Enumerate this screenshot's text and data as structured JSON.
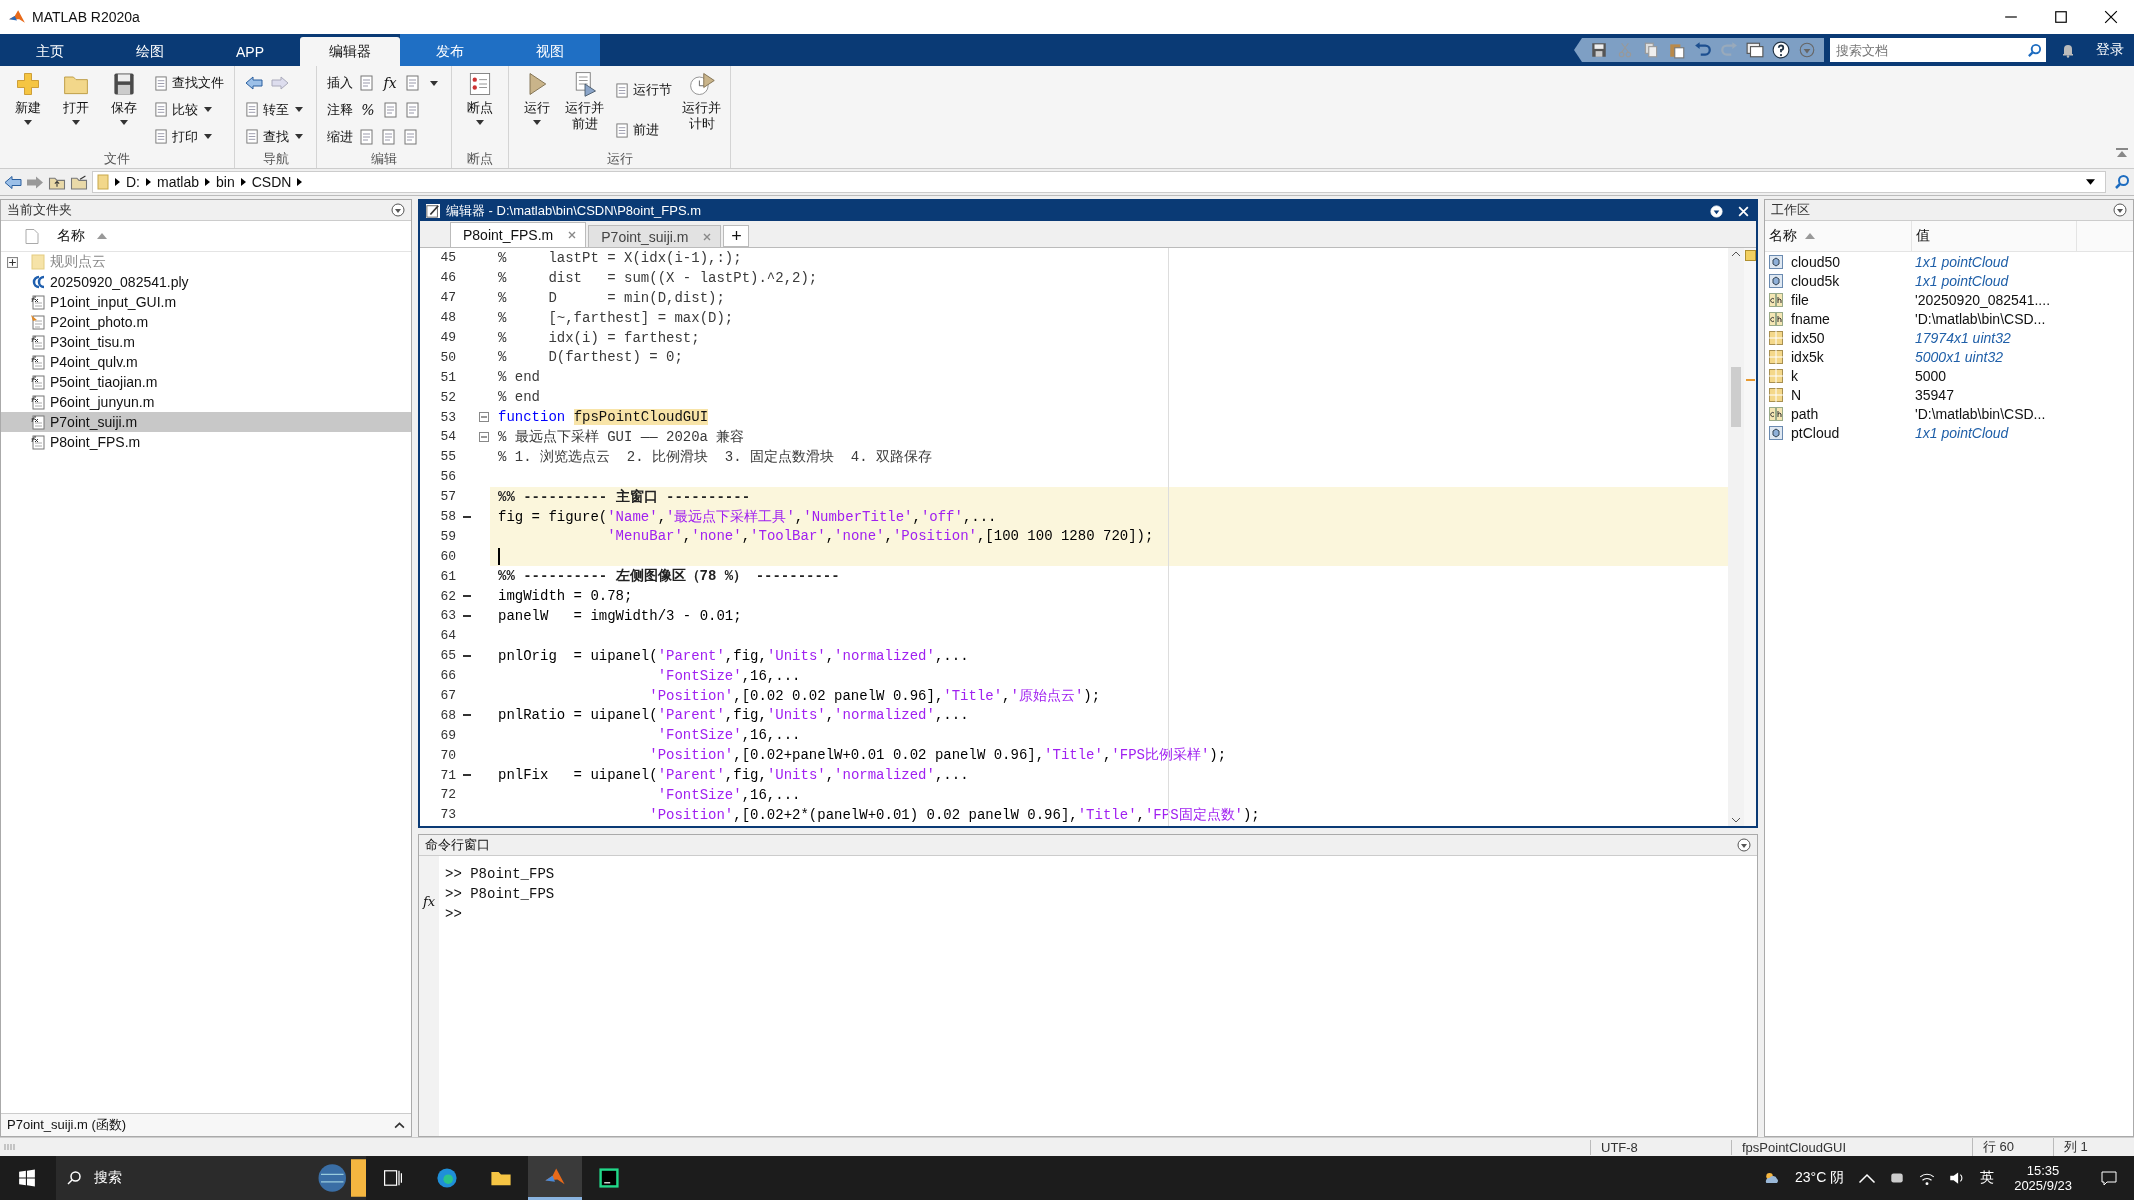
{
  "window": {
    "title": "MATLAB R2020a"
  },
  "tabs": [
    {
      "label": "主页",
      "selected": false,
      "contextual": false
    },
    {
      "label": "绘图",
      "selected": false,
      "contextual": false
    },
    {
      "label": "APP",
      "selected": false,
      "contextual": false
    },
    {
      "label": "编辑器",
      "selected": true,
      "contextual": true
    },
    {
      "label": "发布",
      "selected": false,
      "contextual": true
    },
    {
      "label": "视图",
      "selected": false,
      "contextual": true
    }
  ],
  "search": {
    "placeholder": "搜索文档"
  },
  "login": "登录",
  "ribbon": [
    {
      "label": "文件",
      "items": [
        {
          "kind": "big",
          "label": "新建",
          "caret": true
        },
        {
          "kind": "big",
          "label": "打开",
          "caret": true
        },
        {
          "kind": "big",
          "label": "保存",
          "caret": true
        },
        {
          "kind": "column",
          "rows": [
            {
              "kind": "small",
              "label": "查找文件",
              "caret": false
            },
            {
              "kind": "small",
              "label": "比较",
              "caret": true
            },
            {
              "kind": "small",
              "label": "打印",
              "caret": true
            }
          ]
        }
      ]
    },
    {
      "label": "导航",
      "items": [
        {
          "kind": "column",
          "rows": [
            {
              "kind": "arrows"
            },
            {
              "kind": "small",
              "label": "转至",
              "caret": true
            },
            {
              "kind": "small",
              "label": "查找",
              "caret": true
            }
          ]
        }
      ]
    },
    {
      "label": "编辑",
      "items": [
        {
          "kind": "column",
          "rows": [
            {
              "kind": "tools",
              "label": "插入",
              "tools": [
                {
                  "kind": "icon"
                },
                {
                  "kind": "glyph",
                  "text": "fx"
                },
                {
                  "kind": "icon",
                  "caret": true
                }
              ]
            },
            {
              "kind": "tools",
              "label": "注释",
              "tools": [
                {
                  "kind": "glyph",
                  "text": "%"
                },
                {
                  "kind": "icon"
                },
                {
                  "kind": "icon"
                }
              ]
            },
            {
              "kind": "tools",
              "label": "缩进",
              "tools": [
                {
                  "kind": "icon"
                },
                {
                  "kind": "icon"
                },
                {
                  "kind": "icon"
                }
              ]
            }
          ]
        }
      ]
    },
    {
      "label": "断点",
      "items": [
        {
          "kind": "big",
          "label": "断点",
          "caret": true
        }
      ]
    },
    {
      "label": "运行",
      "items": [
        {
          "kind": "big",
          "label": "运行",
          "caret": true
        },
        {
          "kind": "big",
          "label": "运行并前进",
          "caret": false
        },
        {
          "kind": "column",
          "rows": [
            {
              "kind": "small",
              "label": "运行节",
              "caret": false
            },
            {
              "kind": "small",
              "label": "前进",
              "caret": false
            }
          ]
        },
        {
          "kind": "big",
          "label": "运行并计时",
          "caret": false
        }
      ]
    }
  ],
  "path": [
    "D:",
    "matlab",
    "bin",
    "CSDN"
  ],
  "current_folder": {
    "title": "当前文件夹",
    "column": "名称",
    "items": [
      {
        "name": "规则点云",
        "kind": "folder",
        "selected": false
      },
      {
        "name": "20250920_082541.ply",
        "kind": "ply",
        "selected": false
      },
      {
        "name": "P1oint_input_GUI.m",
        "kind": "function",
        "selected": false
      },
      {
        "name": "P2oint_photo.m",
        "kind": "script",
        "selected": false
      },
      {
        "name": "P3oint_tisu.m",
        "kind": "function",
        "selected": false
      },
      {
        "name": "P4oint_qulv.m",
        "kind": "function",
        "selected": false
      },
      {
        "name": "P5oint_tiaojian.m",
        "kind": "function",
        "selected": false
      },
      {
        "name": "P6oint_junyun.m",
        "kind": "function",
        "selected": false
      },
      {
        "name": "P7oint_suiji.m",
        "kind": "function",
        "selected": true
      },
      {
        "name": "P8oint_FPS.m",
        "kind": "function",
        "selected": false
      }
    ],
    "details": "P7oint_suiji.m  (函数)"
  },
  "editor": {
    "title": "编辑器 - D:\\matlab\\bin\\CSDN\\P8oint_FPS.m",
    "tabs": [
      {
        "label": "P8oint_FPS.m",
        "selected": true
      },
      {
        "label": "P7oint_suiji.m",
        "selected": false
      }
    ],
    "add_tab": "+",
    "lines": [
      {
        "number": "45",
        "executable": false,
        "fold": false,
        "cell": false,
        "cursor": false,
        "segments": [
          {
            "kind": "comment",
            "text": "%     lastPt = X(idx(i-1),:);"
          }
        ]
      },
      {
        "number": "46",
        "executable": false,
        "fold": false,
        "cell": false,
        "cursor": false,
        "segments": [
          {
            "kind": "comment",
            "text": "%     dist   = sum((X - lastPt).^2,2);"
          }
        ]
      },
      {
        "number": "47",
        "executable": false,
        "fold": false,
        "cell": false,
        "cursor": false,
        "segments": [
          {
            "kind": "comment",
            "text": "%     D      = min(D,dist);"
          }
        ]
      },
      {
        "number": "48",
        "executable": false,
        "fold": false,
        "cell": false,
        "cursor": false,
        "segments": [
          {
            "kind": "comment",
            "text": "%     [~,farthest] = max(D);"
          }
        ]
      },
      {
        "number": "49",
        "executable": false,
        "fold": false,
        "cell": false,
        "cursor": false,
        "segments": [
          {
            "kind": "comment",
            "text": "%     idx(i) = farthest;"
          }
        ]
      },
      {
        "number": "50",
        "executable": false,
        "fold": false,
        "cell": false,
        "cursor": false,
        "segments": [
          {
            "kind": "comment",
            "text": "%     D(farthest) = 0;"
          }
        ]
      },
      {
        "number": "51",
        "executable": false,
        "fold": false,
        "cell": false,
        "cursor": false,
        "segments": [
          {
            "kind": "comment",
            "text": "% end"
          }
        ]
      },
      {
        "number": "52",
        "executable": false,
        "fold": false,
        "cell": false,
        "cursor": false,
        "segments": [
          {
            "kind": "comment",
            "text": "% end"
          }
        ]
      },
      {
        "number": "53",
        "executable": false,
        "fold": true,
        "cell": false,
        "cursor": false,
        "segments": [
          {
            "kind": "keyword",
            "text": "function "
          },
          {
            "kind": "highlight",
            "text": "fpsPointCloudGUI"
          }
        ]
      },
      {
        "number": "54",
        "executable": false,
        "fold": true,
        "cell": false,
        "cursor": false,
        "segments": [
          {
            "kind": "comment",
            "text": "% 最远点下采样 GUI —— 2020a 兼容"
          }
        ]
      },
      {
        "number": "55",
        "executable": false,
        "fold": false,
        "cell": false,
        "cursor": false,
        "segments": [
          {
            "kind": "comment",
            "text": "% 1. 浏览选点云  2. 比例滑块  3. 固定点数滑块  4. 双路保存"
          }
        ]
      },
      {
        "number": "56",
        "executable": false,
        "fold": false,
        "cell": false,
        "cursor": false
      },
      {
        "number": "57",
        "executable": false,
        "fold": false,
        "cell": true,
        "cursor": false,
        "segments": [
          {
            "kind": "section",
            "text": "%% ---------- 主窗口 ----------"
          }
        ]
      },
      {
        "number": "58",
        "executable": true,
        "fold": false,
        "cell": true,
        "cursor": false,
        "segments": [
          {
            "kind": "code",
            "text": "fig = figure("
          },
          {
            "kind": "string",
            "text": "'Name'"
          },
          {
            "kind": "code",
            "text": ","
          },
          {
            "kind": "string",
            "text": "'最远点下采样工具'"
          },
          {
            "kind": "code",
            "text": ","
          },
          {
            "kind": "string",
            "text": "'NumberTitle'"
          },
          {
            "kind": "code",
            "text": ","
          },
          {
            "kind": "string",
            "text": "'off'"
          },
          {
            "kind": "code",
            "text": ",..."
          }
        ]
      },
      {
        "number": "59",
        "executable": false,
        "fold": false,
        "cell": true,
        "cursor": false,
        "segments": [
          {
            "kind": "string",
            "text": "             'MenuBar'"
          },
          {
            "kind": "code",
            "text": ","
          },
          {
            "kind": "string",
            "text": "'none'"
          },
          {
            "kind": "code",
            "text": ","
          },
          {
            "kind": "string",
            "text": "'ToolBar'"
          },
          {
            "kind": "code",
            "text": ","
          },
          {
            "kind": "string",
            "text": "'none'"
          },
          {
            "kind": "code",
            "text": ","
          },
          {
            "kind": "string",
            "text": "'Position'"
          },
          {
            "kind": "code",
            "text": ",[100 100 1280 720]);"
          }
        ]
      },
      {
        "number": "60",
        "executable": false,
        "fold": false,
        "cell": true,
        "cursor": true
      },
      {
        "number": "61",
        "executable": false,
        "fold": false,
        "cell": false,
        "cursor": false,
        "segments": [
          {
            "kind": "section",
            "text": "%% ---------- 左侧图像区（78 %） ----------"
          }
        ]
      },
      {
        "number": "62",
        "executable": true,
        "fold": false,
        "cell": false,
        "cursor": false,
        "segments": [
          {
            "kind": "code",
            "text": "imgWidth = 0.78;"
          }
        ]
      },
      {
        "number": "63",
        "executable": true,
        "fold": false,
        "cell": false,
        "cursor": false,
        "segments": [
          {
            "kind": "code",
            "text": "panelW   = imgWidth/3 - 0.01;"
          }
        ]
      },
      {
        "number": "64",
        "executable": false,
        "fold": false,
        "cell": false,
        "cursor": false
      },
      {
        "number": "65",
        "executable": true,
        "fold": false,
        "cell": false,
        "cursor": false,
        "segments": [
          {
            "kind": "code",
            "text": "pnlOrig  = uipanel("
          },
          {
            "kind": "string",
            "text": "'Parent'"
          },
          {
            "kind": "code",
            "text": ",fig,"
          },
          {
            "kind": "string",
            "text": "'Units'"
          },
          {
            "kind": "code",
            "text": ","
          },
          {
            "kind": "string",
            "text": "'normalized'"
          },
          {
            "kind": "code",
            "text": ",..."
          }
        ]
      },
      {
        "number": "66",
        "executable": false,
        "fold": false,
        "cell": false,
        "cursor": false,
        "segments": [
          {
            "kind": "string",
            "text": "                   'FontSize'"
          },
          {
            "kind": "code",
            "text": ",16,..."
          }
        ]
      },
      {
        "number": "67",
        "executable": false,
        "fold": false,
        "cell": false,
        "cursor": false,
        "segments": [
          {
            "kind": "string",
            "text": "                  'Position'"
          },
          {
            "kind": "code",
            "text": ",[0.02 0.02 panelW 0.96],"
          },
          {
            "kind": "string",
            "text": "'Title'"
          },
          {
            "kind": "code",
            "text": ","
          },
          {
            "kind": "string",
            "text": "'原始点云'"
          },
          {
            "kind": "code",
            "text": ");"
          }
        ]
      },
      {
        "number": "68",
        "executable": true,
        "fold": false,
        "cell": false,
        "cursor": false,
        "segments": [
          {
            "kind": "code",
            "text": "pnlRatio = uipanel("
          },
          {
            "kind": "string",
            "text": "'Parent'"
          },
          {
            "kind": "code",
            "text": ",fig,"
          },
          {
            "kind": "string",
            "text": "'Units'"
          },
          {
            "kind": "code",
            "text": ","
          },
          {
            "kind": "string",
            "text": "'normalized'"
          },
          {
            "kind": "code",
            "text": ",..."
          }
        ]
      },
      {
        "number": "69",
        "executable": false,
        "fold": false,
        "cell": false,
        "cursor": false,
        "segments": [
          {
            "kind": "string",
            "text": "                   'FontSize'"
          },
          {
            "kind": "code",
            "text": ",16,..."
          }
        ]
      },
      {
        "number": "70",
        "executable": false,
        "fold": false,
        "cell": false,
        "cursor": false,
        "segments": [
          {
            "kind": "string",
            "text": "                  'Position'"
          },
          {
            "kind": "code",
            "text": ",[0.02+panelW+0.01 0.02 panelW 0.96],"
          },
          {
            "kind": "string",
            "text": "'Title'"
          },
          {
            "kind": "code",
            "text": ","
          },
          {
            "kind": "string",
            "text": "'FPS比例采样'"
          },
          {
            "kind": "code",
            "text": ");"
          }
        ]
      },
      {
        "number": "71",
        "executable": true,
        "fold": false,
        "cell": false,
        "cursor": false,
        "segments": [
          {
            "kind": "code",
            "text": "pnlFix   = uipanel("
          },
          {
            "kind": "string",
            "text": "'Parent'"
          },
          {
            "kind": "code",
            "text": ",fig,"
          },
          {
            "kind": "string",
            "text": "'Units'"
          },
          {
            "kind": "code",
            "text": ","
          },
          {
            "kind": "string",
            "text": "'normalized'"
          },
          {
            "kind": "code",
            "text": ",..."
          }
        ]
      },
      {
        "number": "72",
        "executable": false,
        "fold": false,
        "cell": false,
        "cursor": false,
        "segments": [
          {
            "kind": "string",
            "text": "                   'FontSize'"
          },
          {
            "kind": "code",
            "text": ",16,..."
          }
        ]
      },
      {
        "number": "73",
        "executable": false,
        "fold": false,
        "cell": false,
        "cursor": false,
        "segments": [
          {
            "kind": "string",
            "text": "                  'Position'"
          },
          {
            "kind": "code",
            "text": ",[0.02+2*(panelW+0.01) 0.02 panelW 0.96],"
          },
          {
            "kind": "string",
            "text": "'Title'"
          },
          {
            "kind": "code",
            "text": ","
          },
          {
            "kind": "string",
            "text": "'FPS固定点数'"
          },
          {
            "kind": "code",
            "text": ");"
          }
        ]
      }
    ]
  },
  "command_window": {
    "title": "命令行窗口",
    "history": [
      ">> P8oint_FPS",
      ">> P8oint_FPS"
    ],
    "prompt_icon": "fx",
    "prompt": ">>"
  },
  "workspace": {
    "title": "工作区",
    "columns": [
      "名称",
      "值"
    ],
    "rows": [
      {
        "name": "cloud50",
        "value": "1x1 pointCloud",
        "kind": "object",
        "summary": true
      },
      {
        "name": "cloud5k",
        "value": "1x1 pointCloud",
        "kind": "object",
        "summary": true
      },
      {
        "name": "file",
        "value": "'20250920_082541....",
        "kind": "char",
        "summary": false
      },
      {
        "name": "fname",
        "value": "'D:\\matlab\\bin\\CSD...",
        "kind": "char",
        "summary": false
      },
      {
        "name": "idx50",
        "value": "17974x1 uint32",
        "kind": "numeric",
        "summary": true
      },
      {
        "name": "idx5k",
        "value": "5000x1 uint32",
        "kind": "numeric",
        "summary": true
      },
      {
        "name": "k",
        "value": "5000",
        "kind": "numeric",
        "summary": false
      },
      {
        "name": "N",
        "value": "35947",
        "kind": "numeric",
        "summary": false
      },
      {
        "name": "path",
        "value": "'D:\\matlab\\bin\\CSD...",
        "kind": "char",
        "summary": false
      },
      {
        "name": "ptCloud",
        "value": "1x1 pointCloud",
        "kind": "object",
        "summary": true
      }
    ]
  },
  "status_bar": [
    "UTF-8",
    "fpsPointCloudGUI",
    "行  60",
    "列  1"
  ],
  "taskbar": {
    "search": "搜索",
    "apps": [
      {
        "kind": "taskview",
        "selected": false
      },
      {
        "kind": "edge",
        "selected": false
      },
      {
        "kind": "explorer",
        "selected": false
      },
      {
        "kind": "matlab",
        "selected": true
      },
      {
        "kind": "pycharm",
        "selected": false
      }
    ],
    "weather": "23°C 阴",
    "ime": "英",
    "time": "15:35",
    "date": "2025/9/23"
  }
}
